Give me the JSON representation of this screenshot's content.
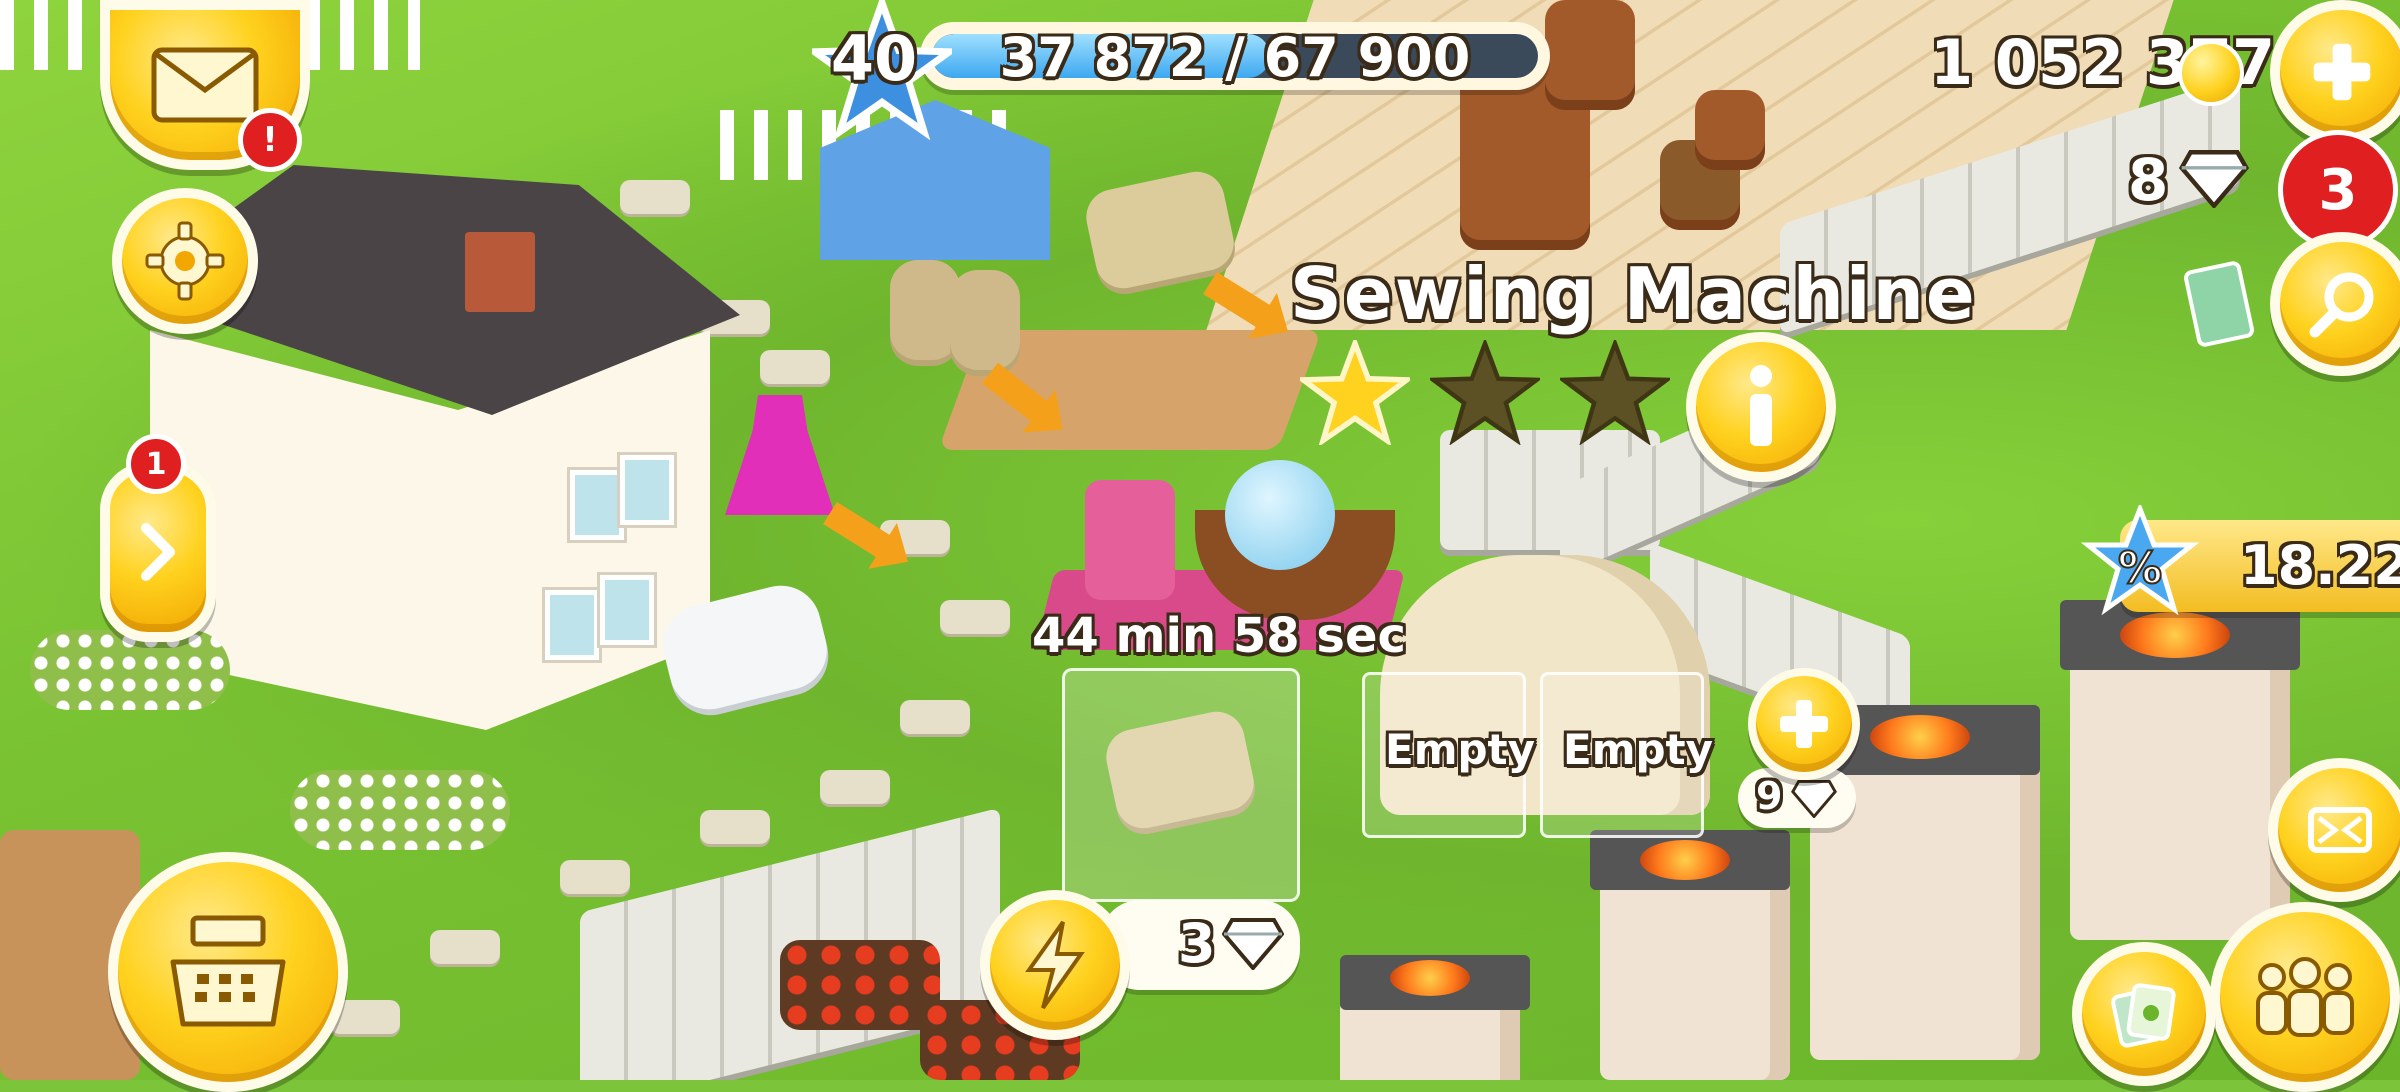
{
  "hud": {
    "level": "40",
    "xp_text": "37 872 / 67 900",
    "xp_fraction": 0.558,
    "coins": "1 052 377",
    "diamonds": "8",
    "diamond_badge": "3",
    "mail_badge": "!",
    "side_badge": "1",
    "sale_timer": "18.22"
  },
  "building": {
    "title": "Sewing Machine",
    "stars_filled": 1,
    "stars_total": 3,
    "timer": "44 min 58 sec",
    "finish_cost": "3",
    "slots": [
      "Empty",
      "Empty"
    ],
    "add_slot_cost": "9"
  },
  "colors": {
    "gold": "#ffd21f",
    "xp_fill": "#3da8f0",
    "badge_red": "#e02020",
    "grass": "#7cc43a"
  },
  "icons": {
    "mail": "envelope-icon",
    "settings": "gear-icon",
    "expand": "chevron-right-icon",
    "shop": "cash-register-icon",
    "speed": "lightning-icon",
    "add_coins": "plus-icon",
    "search": "magnifier-icon",
    "info": "info-icon",
    "zoom": "expand-arrows-icon",
    "friends": "people-icon",
    "cards": "cards-icon"
  }
}
